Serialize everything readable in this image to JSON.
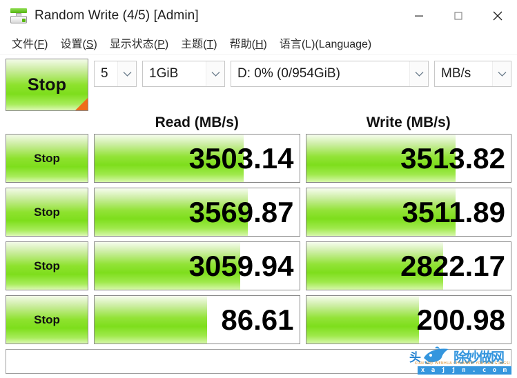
{
  "window": {
    "title": "Random Write (4/5) [Admin]",
    "icon": "disk-drive-icon",
    "minimize_label": "—",
    "maximize_label": "□",
    "close_label": "✕"
  },
  "menubar": {
    "items": [
      {
        "text": "文件",
        "mnemonic": "F"
      },
      {
        "text": "设置",
        "mnemonic": "S"
      },
      {
        "text": "显示状态",
        "mnemonic": "P"
      },
      {
        "text": "主题",
        "mnemonic": "T"
      },
      {
        "text": "帮助",
        "mnemonic": "H"
      },
      {
        "text": "语言",
        "mnemonic": "L",
        "suffix": "(Language)"
      }
    ]
  },
  "toolbar": {
    "run_button_label": "Stop",
    "test_count": "5",
    "test_size": "1GiB",
    "drive": "D: 0% (0/954GiB)",
    "unit": "MB/s"
  },
  "headers": {
    "read": "Read (MB/s)",
    "write": "Write (MB/s)"
  },
  "rows": [
    {
      "stop_label": "Stop",
      "read_value": "3503.14",
      "write_value": "3513.82",
      "read_fill_pct": 73,
      "write_fill_pct": 73
    },
    {
      "stop_label": "Stop",
      "read_value": "3569.87",
      "write_value": "3511.89",
      "read_fill_pct": 75,
      "write_fill_pct": 73
    },
    {
      "stop_label": "Stop",
      "read_value": "3059.94",
      "write_value": "2822.17",
      "read_fill_pct": 71,
      "write_fill_pct": 67
    },
    {
      "stop_label": "Stop",
      "read_value": "86.61",
      "write_value": "200.98",
      "read_fill_pct": 55,
      "write_fill_pct": 55
    }
  ],
  "statusbar": {
    "text": ""
  },
  "watermark": {
    "head": "头",
    "cn": "除妙做网",
    "url": "x a j j n . c o m",
    "sub": "XIAN ANJI WENHUA CHUANMEI YOUXIAN GONGSI"
  },
  "colors": {
    "bar_green": "#7ede1c",
    "bar_green_light": "#d6f7aa",
    "button_border": "#8a8a8a",
    "corner_orange": "#ef6c1b",
    "watermark_blue": "#2f93dd"
  }
}
